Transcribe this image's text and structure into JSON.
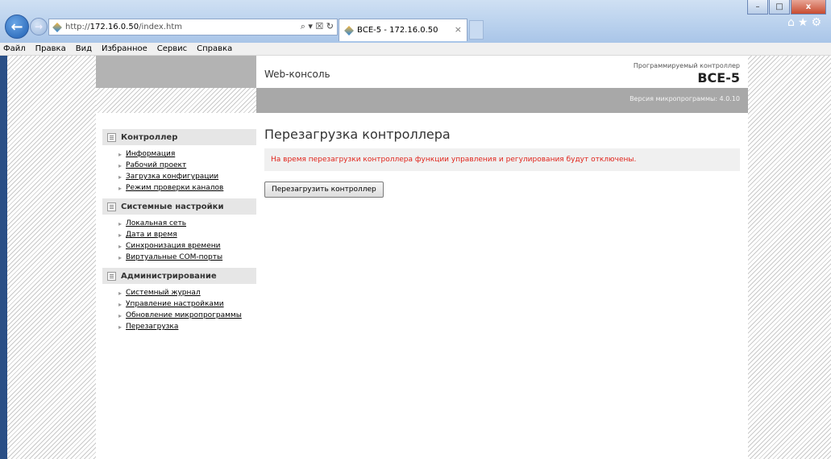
{
  "browser": {
    "address_prefix": "http://",
    "address_host": "172.16.0.50",
    "address_path": "/index.htm",
    "address_tools": "⌕ ▾ ☒ ↻",
    "tab_title": "ВСЕ-5 - 172.16.0.50",
    "tab_close": "×",
    "window_buttons": {
      "minimize": "–",
      "maximize": "□",
      "close": "x"
    },
    "nav": {
      "back": "←",
      "forward": "→"
    },
    "right_icons": "⌂★⚙",
    "menu": [
      "Файл",
      "Правка",
      "Вид",
      "Избранное",
      "Сервис",
      "Справка"
    ]
  },
  "header": {
    "brand": "Web-консоль",
    "product_subtitle": "Программируемый контроллер",
    "product_name": "ВСЕ-5",
    "firmware": "Версия микропрограммы: 4.0.10"
  },
  "sidebar": {
    "sections": [
      {
        "title": "Контроллер",
        "items": [
          "Информация",
          "Рабочий проект",
          "Загрузка конфигурации",
          "Режим проверки каналов"
        ]
      },
      {
        "title": "Системные настройки",
        "items": [
          "Локальная сеть",
          "Дата и время",
          "Синхронизация времени",
          "Виртуальные COM-порты"
        ]
      },
      {
        "title": "Администрирование",
        "items": [
          "Системный журнал",
          "Управление настройками",
          "Обновление микропрограммы",
          "Перезагрузка"
        ]
      }
    ]
  },
  "main": {
    "title": "Перезагрузка контроллера",
    "warning": "На время перезагрузки контроллера функции управления и регулирования будут отключены.",
    "button_label": "Перезагрузить контроллер"
  },
  "colors": {
    "warning_text": "#e0241b",
    "header_band": "#a8a8a8"
  }
}
